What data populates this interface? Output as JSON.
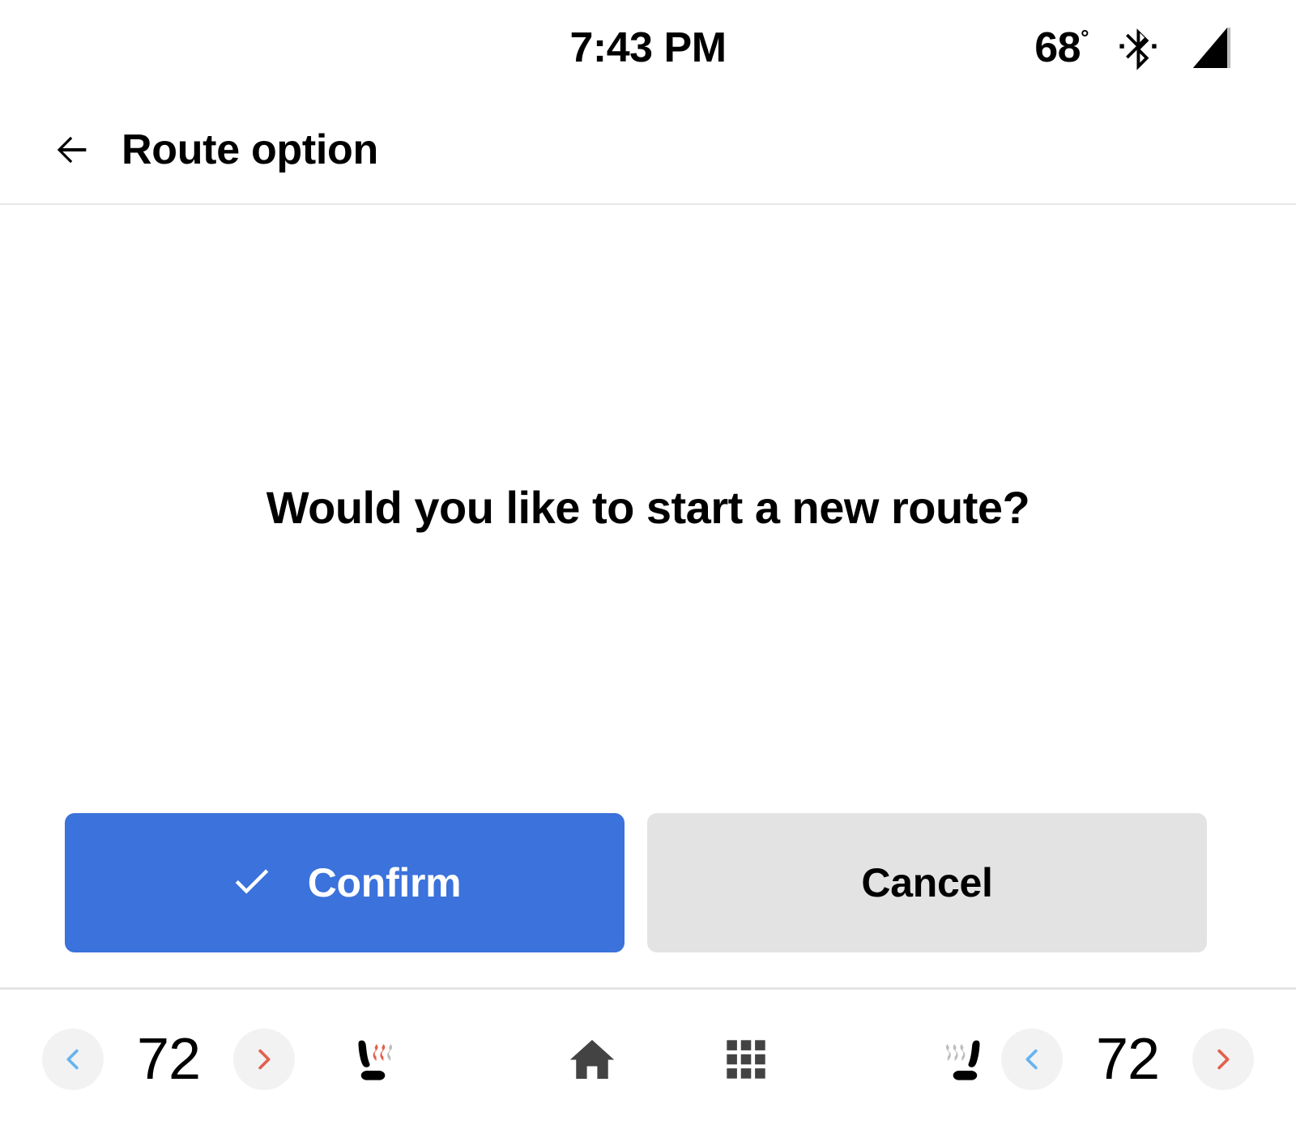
{
  "status_bar": {
    "time": "7:43 PM",
    "temperature": "68",
    "degree_symbol": "°",
    "bluetooth_icon": "bluetooth-icon",
    "signal_icon": "cellular-signal-icon"
  },
  "header": {
    "back_icon": "back-arrow-icon",
    "title": "Route option"
  },
  "main": {
    "prompt": "Would you like to start a new route?",
    "confirm_button": {
      "label": "Confirm",
      "icon": "check-icon",
      "color": "#3b72db",
      "text_color": "#ffffff"
    },
    "cancel_button": {
      "label": "Cancel",
      "color": "#e3e3e3",
      "text_color": "#000000"
    }
  },
  "climate_bar": {
    "driver": {
      "decrease_icon": "chevron-left-icon",
      "temperature": "72",
      "increase_icon": "chevron-right-icon",
      "seat_heater_icon": "heated-seat-icon",
      "seat_heater_level": 2
    },
    "passenger": {
      "decrease_icon": "chevron-left-icon",
      "temperature": "72",
      "increase_icon": "chevron-right-icon",
      "seat_heater_icon": "heated-seat-icon",
      "seat_heater_level": 0
    },
    "home_icon": "home-icon",
    "apps_icon": "apps-grid-icon",
    "colors": {
      "decrease_arrow": "#66b3f0",
      "increase_arrow": "#e2604f",
      "circle_background": "#f2f2f2",
      "heat_active": "#e2604f",
      "heat_inactive": "#bdbdbd",
      "nav_icon": "#434343"
    }
  }
}
